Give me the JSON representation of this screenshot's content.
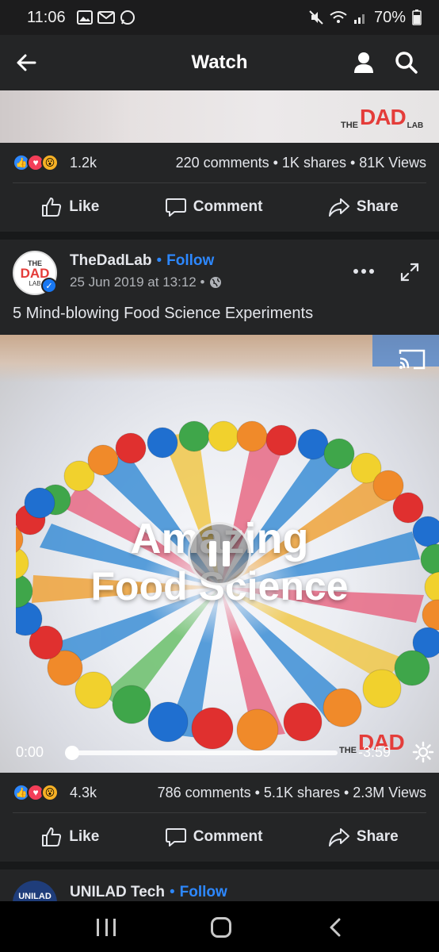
{
  "status_bar": {
    "time": "11:06",
    "battery": "70%"
  },
  "app_bar": {
    "title": "Watch"
  },
  "watermark": {
    "the": "THE",
    "dad": "DAD",
    "lab": "LAB"
  },
  "post1": {
    "reaction_count": "1.2k",
    "meta": "220 comments • 1K shares • 81K Views",
    "like_label": "Like",
    "comment_label": "Comment",
    "share_label": "Share"
  },
  "post2": {
    "page_name": "TheDadLab",
    "follow_label": "Follow",
    "timestamp": "25 Jun 2019 at 13:12 •",
    "text": "5 Mind-blowing Food Science Experiments",
    "avatar": {
      "the": "THE",
      "dad": "DAD",
      "lab": "LAB"
    },
    "video": {
      "overlay_line1": "Amazing",
      "overlay_line2": "Food Science",
      "current_time": "0:00",
      "duration": "-3:59",
      "progress": 0
    },
    "reaction_count": "4.3k",
    "meta": "786 comments • 5.1K shares • 2.3M Views",
    "like_label": "Like",
    "comment_label": "Comment",
    "share_label": "Share"
  },
  "post3": {
    "page_name": "UNILAD Tech",
    "follow_label": "Follow",
    "avatar_text": "UNILAD"
  },
  "colors": {
    "background": "#18191a",
    "card": "#242526",
    "accent": "#2d88ff",
    "text": "#e4e6eb",
    "secondary_text": "#b0b3b8"
  }
}
